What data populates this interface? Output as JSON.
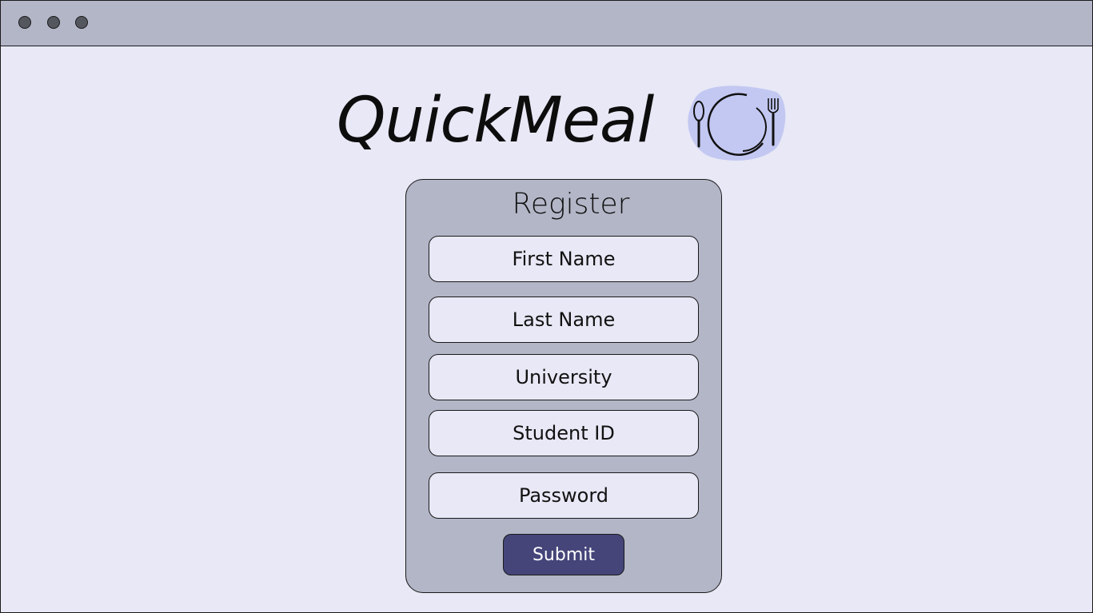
{
  "app": {
    "title": "QuickMeal",
    "logo_icon": "plate-with-spoon-and-fork-icon"
  },
  "window_controls": [
    "dot",
    "dot",
    "dot"
  ],
  "colors": {
    "background": "#e8e8f6",
    "titlebar": "#b3b6c7",
    "panel": "#b3b6c7",
    "submit": "#45457a",
    "logo_blob": "#c3c8f2"
  },
  "form": {
    "title": "Register",
    "fields": {
      "first_name": "First Name",
      "last_name": "Last Name",
      "university": "University",
      "student_id": "Student ID",
      "password": "Password"
    },
    "submit_label": "Submit"
  }
}
